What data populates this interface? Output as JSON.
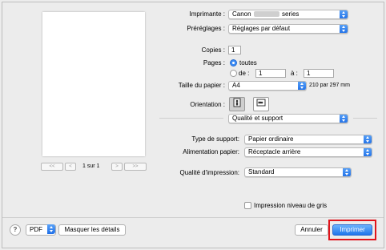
{
  "printer": {
    "label": "Imprimante :",
    "value_prefix": "Canon",
    "value_suffix": "series"
  },
  "presets": {
    "label": "Préréglages :",
    "value": "Réglages par défaut"
  },
  "copies": {
    "label": "Copies :",
    "value": "1"
  },
  "pages": {
    "label": "Pages :",
    "all_label": "toutes",
    "from_label": "de :",
    "from_value": "1",
    "to_label": "à :",
    "to_value": "1"
  },
  "paper_size": {
    "label": "Taille du papier :",
    "value": "A4",
    "dimensions": "210 par 297 mm"
  },
  "orientation": {
    "label": "Orientation :"
  },
  "section": {
    "value": "Qualité et support"
  },
  "media_type": {
    "label": "Type de support:",
    "value": "Papier ordinaire"
  },
  "paper_source": {
    "label": "Alimentation papier:",
    "value": "Réceptacle arrière"
  },
  "print_quality": {
    "label": "Qualité d'impression:",
    "value": "Standard"
  },
  "grayscale": {
    "label": "Impression niveau de gris",
    "checked": false
  },
  "preview_nav": {
    "first": "<<",
    "prev": "<",
    "page_info": "1 sur 1",
    "next": ">",
    "last": ">>"
  },
  "footer": {
    "help": "?",
    "pdf": "PDF",
    "hide_details": "Masquer les détails",
    "cancel": "Annuler",
    "print": "Imprimer"
  },
  "colors": {
    "accent": "#1f76ec",
    "highlight": "#e0141b"
  },
  "icons": {
    "stepper": "up-down-arrows-icon",
    "portrait": "portrait-orientation-icon",
    "landscape": "landscape-orientation-icon"
  }
}
